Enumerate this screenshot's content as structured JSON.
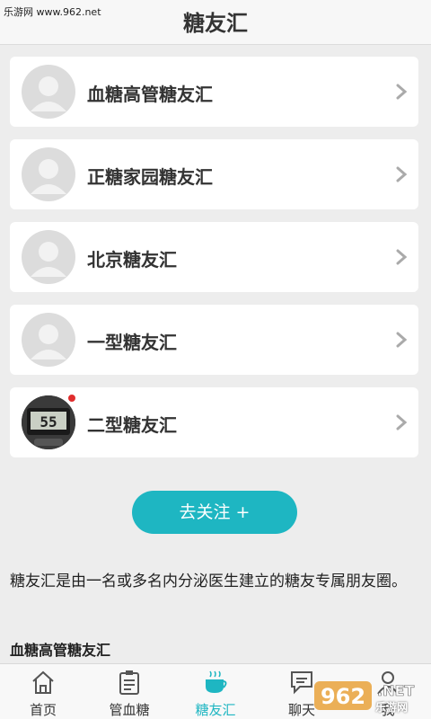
{
  "header": {
    "watermark": "乐游网 www.962.net",
    "title": "糖友汇"
  },
  "groups": [
    {
      "label": "血糖高管糖友汇"
    },
    {
      "label": "正糖家园糖友汇"
    },
    {
      "label": "北京糖友汇"
    },
    {
      "label": "一型糖友汇"
    },
    {
      "label": "二型糖友汇",
      "meter_reading": "55",
      "has_unread": true
    }
  ],
  "follow_button": "去关注 +",
  "description": "糖友汇是由一名或多名内分泌医生建立的糖友专属朋友圈。",
  "section_title": "血糖高管糖友汇",
  "tabs": [
    {
      "label": "首页",
      "icon": "home-icon"
    },
    {
      "label": "管血糖",
      "icon": "clipboard-icon"
    },
    {
      "label": "糖友汇",
      "icon": "coffee-cup-icon",
      "active": true
    },
    {
      "label": "聊天",
      "icon": "chat-icon"
    },
    {
      "label": "我",
      "icon": "person-icon"
    }
  ],
  "brand_watermark": "乐游网",
  "colors": {
    "accent": "#1eb6c2",
    "badge": "#e02d2d",
    "background": "#ededed"
  }
}
